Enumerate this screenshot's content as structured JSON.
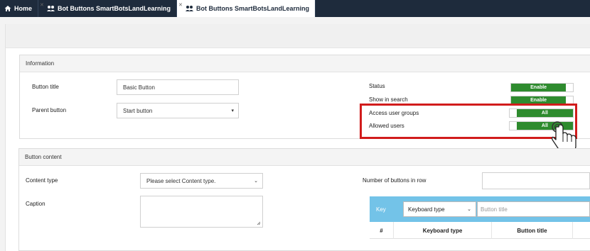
{
  "tabs": [
    {
      "label": "Home",
      "icon": "home-icon"
    },
    {
      "label": "Bot Buttons SmartBotsLandLearning",
      "icon": "bot-icon"
    },
    {
      "label": "Bot Buttons SmartBotsLandLearning",
      "icon": "bot-icon"
    }
  ],
  "information": {
    "header": "Information",
    "button_title_label": "Button title",
    "button_title_value": "Basic Button",
    "parent_button_label": "Parent button",
    "parent_button_value": "Start button",
    "status_label": "Status",
    "status_value": "Enable",
    "show_in_search_label": "Show in search",
    "show_in_search_value": "Enable",
    "access_user_groups_label": "Access user groups",
    "access_user_groups_value": "All",
    "allowed_users_label": "Allowed users",
    "allowed_users_value": "All"
  },
  "button_content": {
    "header": "Button content",
    "content_type_label": "Content type",
    "content_type_placeholder": "Please select Content type.",
    "caption_label": "Caption",
    "buttons_in_row_label": "Number of buttons in row",
    "key_label": "Key",
    "keyboard_type_value": "Keyboard type",
    "button_title_placeholder": "Button title",
    "table_headers": [
      "#",
      "Keyboard type",
      "Button title"
    ]
  },
  "colors": {
    "topbar": "#1e2b3c",
    "toggle_on": "#2e8b2e",
    "highlight": "#d11c1c",
    "key_bar": "#73c3e8"
  }
}
